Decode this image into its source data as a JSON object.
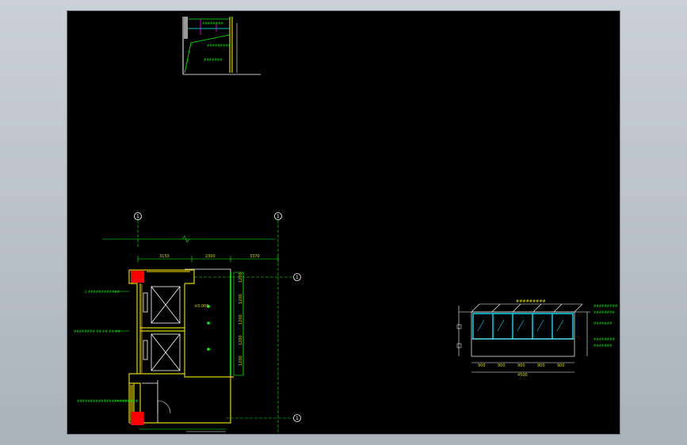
{
  "colors": {
    "background": "#000000",
    "frame": "#bfc6cf",
    "wall_yellow": "#e0d000",
    "line_green": "#00ff00",
    "line_white": "#ffffff",
    "column_red": "#ff0000",
    "glass_cyan": "#00e5ff",
    "accent_magenta": "#ff00ff",
    "text_yellow": "#d8d800"
  },
  "plan": {
    "axis_top_left": "1",
    "axis_top_right": "1",
    "axis_right_upper": "1",
    "axis_right_lower": "1",
    "dims_top": [
      "3150",
      "2300",
      "3370"
    ],
    "dims_right": [
      "1200",
      "1200",
      "1200",
      "1200",
      "1200"
    ],
    "elevation_mark": "±0.000",
    "label_left_1": "2 ############",
    "label_left_2": "######## ## ## ## ##",
    "label_left_3": "#######################"
  },
  "section": {
    "dims_bottom": [
      "900",
      "900",
      "900",
      "900",
      "900"
    ],
    "dim_total": "4500",
    "top_label": "#########",
    "notes_right": [
      "#########",
      "########",
      "#######",
      "########",
      "#######"
    ]
  },
  "detail": {
    "notes": [
      "########",
      "#########",
      "#######"
    ]
  }
}
